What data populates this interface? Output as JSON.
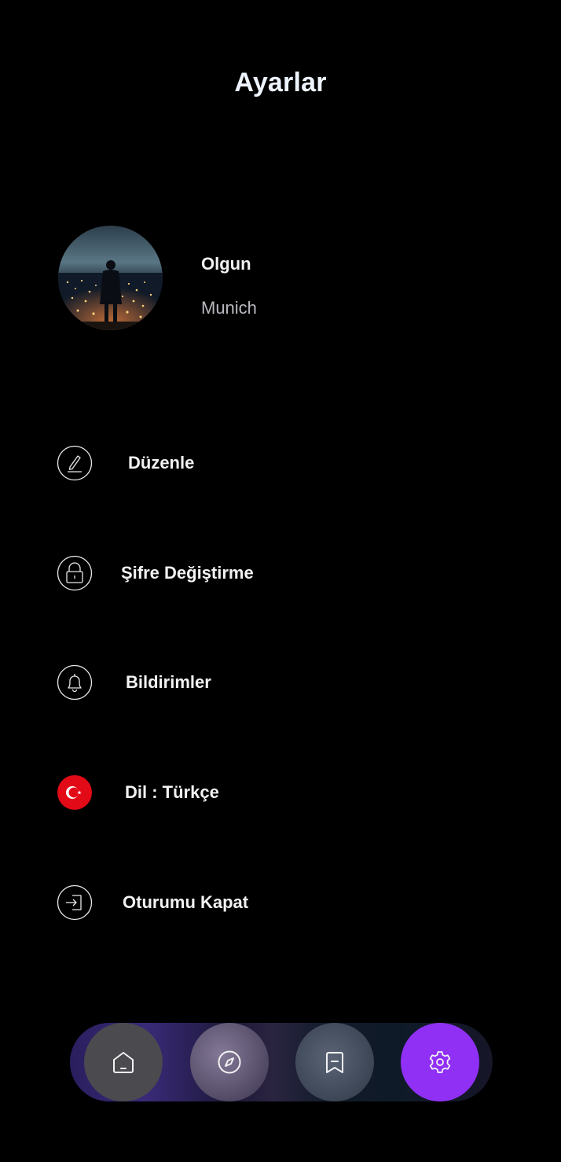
{
  "header": {
    "title": "Ayarlar"
  },
  "profile": {
    "name": "Olgun",
    "location": "Munich"
  },
  "menu": {
    "items": [
      {
        "label": "Düzenle",
        "icon": "pencil-icon"
      },
      {
        "label": "Şifre Değiştirme",
        "icon": "lock-icon"
      },
      {
        "label": "Bildirimler",
        "icon": "bell-icon"
      },
      {
        "label": "Dil : Türkçe",
        "icon": "turkey-flag-icon"
      },
      {
        "label": "Oturumu Kapat",
        "icon": "logout-icon"
      }
    ]
  },
  "bottom_nav": {
    "items": [
      {
        "name": "home",
        "icon": "home-icon",
        "active": false
      },
      {
        "name": "explore",
        "icon": "compass-icon",
        "active": false
      },
      {
        "name": "saved",
        "icon": "bookmark-icon",
        "active": false
      },
      {
        "name": "settings",
        "icon": "gear-icon",
        "active": true
      }
    ]
  },
  "colors": {
    "background": "#000000",
    "accent": "#9030f5",
    "flag_red": "#e30a17",
    "secondary_text": "#b9b9c2"
  }
}
